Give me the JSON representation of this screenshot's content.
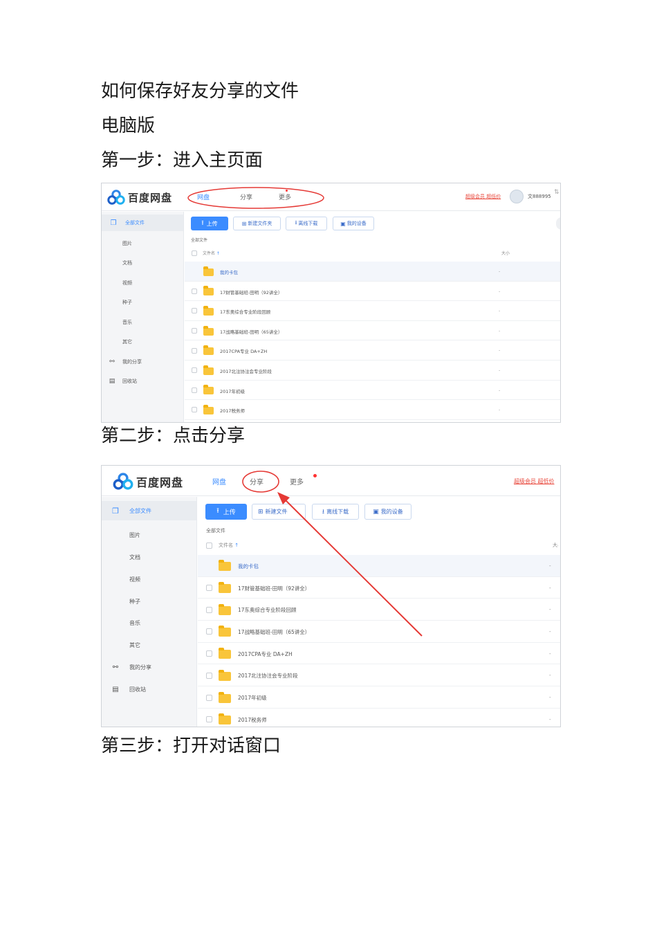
{
  "doc": {
    "title": "如何保存好友分享的文件",
    "version": "电脑版",
    "step1": "第一步：进入主页面",
    "step2": "第二步：点击分享",
    "step3": "第三步：打开对话窗口"
  },
  "app": {
    "logo_text": "百度网盘",
    "nav": [
      "网盘",
      "分享",
      "更多"
    ],
    "vip_link": "超级会员 超低价",
    "user_name": "文888995",
    "sidebar": [
      "全部文件",
      "图片",
      "文档",
      "视频",
      "种子",
      "音乐",
      "其它",
      "我的分享",
      "回收站"
    ],
    "buttons": [
      "上传",
      "新建文件夹",
      "离线下载",
      "我的设备"
    ],
    "buttons_shot2": [
      "上传",
      "新建文件",
      "离线下载",
      "我的设备"
    ],
    "breadcrumb": "全部文件",
    "col_name": "文件名",
    "col_size": "大小",
    "col_size_cut": "大小",
    "files": [
      {
        "name": "我的卡包",
        "size": "-"
      },
      {
        "name": "17财管基础班-田明（92讲全）",
        "size": "-"
      },
      {
        "name": "17东奥综合专业阶段回顾",
        "size": "-"
      },
      {
        "name": "17战略基础班-田明（65讲全）",
        "size": "-"
      },
      {
        "name": "2017CPA专业 DA+ZH",
        "size": "-"
      },
      {
        "name": "2017北注协注会专业阶段",
        "size": "-"
      },
      {
        "name": "2017年初级",
        "size": "-"
      },
      {
        "name": "2017税务师",
        "size": "-"
      }
    ]
  },
  "colors": {
    "accent": "#3b8cff",
    "annotation": "#e53935",
    "folder": "#f9c53a"
  }
}
